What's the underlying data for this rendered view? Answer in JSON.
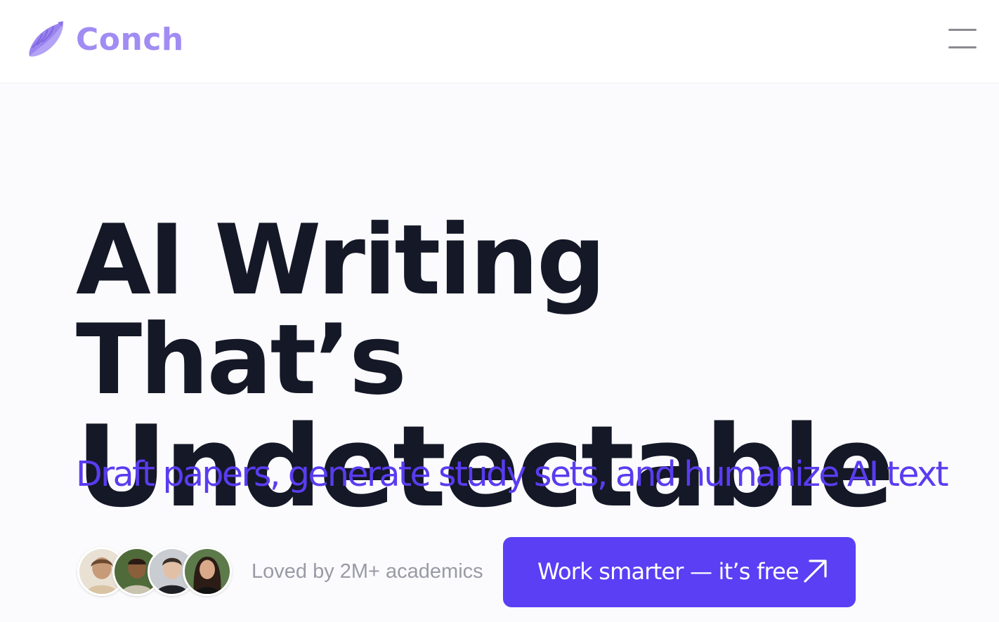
{
  "header": {
    "brand": "Conch",
    "brand_color": "#a18cf3",
    "logo_icon": "conch-shell-icon",
    "menu_icon": "hamburger-menu-icon"
  },
  "hero": {
    "title_line1": "AI Writing That’s",
    "title_line2": "Undetectable",
    "subtitle": "Draft papers, generate study sets, and humanize AI text",
    "subtitle_color": "#5a3cf0",
    "title_color": "#141827"
  },
  "social_proof": {
    "avatars": [
      "avatar-1",
      "avatar-2",
      "avatar-3",
      "avatar-4"
    ],
    "text": "Loved by 2M+ academics"
  },
  "cta": {
    "label": "Work smarter — it’s free",
    "icon": "arrow-up-right-icon",
    "background": "#5a3ff5"
  }
}
